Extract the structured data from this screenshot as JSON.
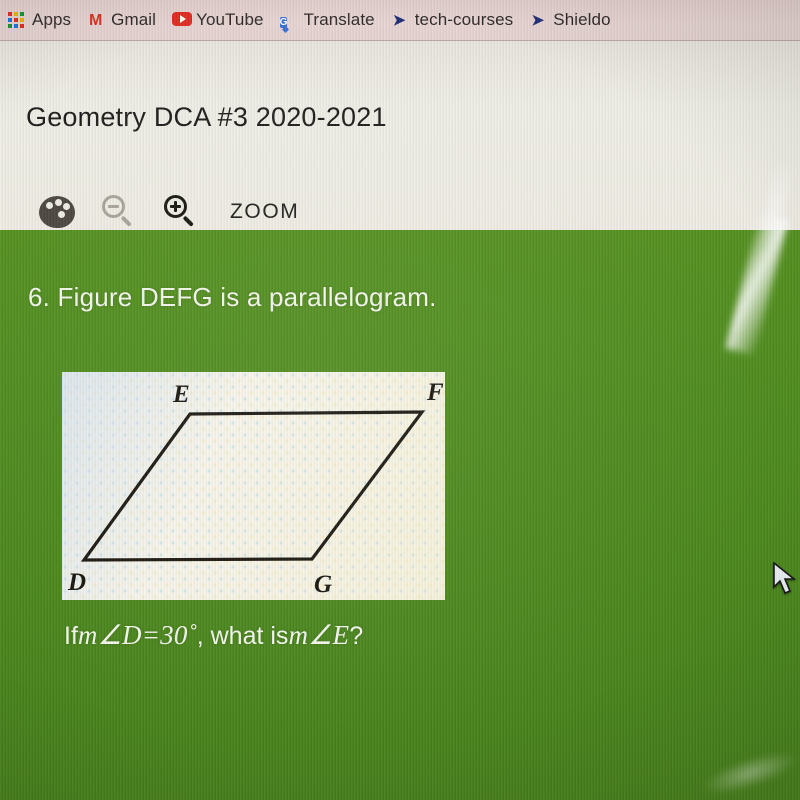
{
  "browser": {
    "bookmarks": [
      {
        "label": "Apps",
        "icon": "apps-grid-icon"
      },
      {
        "label": "Gmail",
        "icon": "gmail-icon"
      },
      {
        "label": "YouTube",
        "icon": "youtube-icon"
      },
      {
        "label": "Translate",
        "icon": "translate-icon"
      },
      {
        "label": "tech-courses",
        "icon": "hawk-logo-icon"
      },
      {
        "label": "Shieldo",
        "icon": "hawk-logo-icon"
      }
    ]
  },
  "app": {
    "document_title": "Geometry DCA #3 2020-2021",
    "toolbar": {
      "palette_icon": "palette-icon",
      "zoom_out_icon": "zoom-out-magnifier-icon",
      "zoom_in_icon": "zoom-in-magnifier-icon",
      "zoom_label": "ZOOM"
    }
  },
  "question": {
    "number": "6.",
    "prompt": "6. Figure DEFG is a parallelogram.",
    "ask_prefix": "If ",
    "ask_math_1": "m∠D",
    "ask_equals": " = ",
    "ask_value": "30˚",
    "ask_middle": ", what is ",
    "ask_math_2": "m∠E",
    "ask_suffix": "?"
  },
  "figure": {
    "name": "parallelogram-DEFG",
    "vertices": [
      {
        "label": "E",
        "position": "top-left"
      },
      {
        "label": "F",
        "position": "top-right"
      },
      {
        "label": "D",
        "position": "bottom-left"
      },
      {
        "label": "G",
        "position": "bottom-right"
      }
    ]
  },
  "colors": {
    "content_green": "#4e8b1d",
    "header_bg": "#eeece3",
    "bookmark_bg": "#e5d3d1",
    "figure_bg": "#f6f4ea",
    "ink": "#17140e",
    "zoom_in_active": "#17150f",
    "zoom_out_disabled": "#a9a49a"
  }
}
